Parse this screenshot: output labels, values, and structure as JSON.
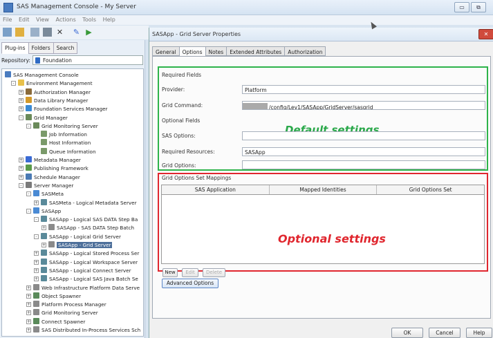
{
  "window": {
    "title": "SAS Management Console - My Server",
    "min_label": "▭",
    "max_label": "⧉"
  },
  "menu": [
    "File",
    "Edit",
    "View",
    "Actions",
    "Tools",
    "Help"
  ],
  "left": {
    "tabs": [
      "Plug-ins",
      "Folders",
      "Search"
    ],
    "repository_label": "Repository:",
    "repository_value": "Foundation",
    "tree": [
      {
        "label": "SAS Management Console",
        "level": 0,
        "exp": "",
        "color": "#4a7cc0"
      },
      {
        "label": "Environment Management",
        "level": 1,
        "exp": "-",
        "color": "#e8c04a"
      },
      {
        "label": "Authorization Manager",
        "level": 2,
        "exp": "+",
        "color": "#8a6a3a"
      },
      {
        "label": "Data Library Manager",
        "level": 2,
        "exp": "+",
        "color": "#d49a2a"
      },
      {
        "label": "Foundation Services Manager",
        "level": 2,
        "exp": "+",
        "color": "#3a8ad4"
      },
      {
        "label": "Grid Manager",
        "level": 2,
        "exp": "-",
        "color": "#6a8a5a"
      },
      {
        "label": "Grid Monitoring Server",
        "level": 3,
        "exp": "-",
        "color": "#6a8a5a"
      },
      {
        "label": "Job Information",
        "level": 4,
        "exp": "",
        "color": "#7a9a6a"
      },
      {
        "label": "Host Information",
        "level": 4,
        "exp": "",
        "color": "#7a9a6a"
      },
      {
        "label": "Queue Information",
        "level": 4,
        "exp": "",
        "color": "#7a9a6a"
      },
      {
        "label": "Metadata Manager",
        "level": 2,
        "exp": "+",
        "color": "#3a6ad4"
      },
      {
        "label": "Publishing Framework",
        "level": 2,
        "exp": "+",
        "color": "#5a9a4a"
      },
      {
        "label": "Schedule Manager",
        "level": 2,
        "exp": "+",
        "color": "#4a7ab4"
      },
      {
        "label": "Server Manager",
        "level": 2,
        "exp": "-",
        "color": "#7a7a7a"
      },
      {
        "label": "SASMeta",
        "level": 3,
        "exp": "-",
        "color": "#4a8ad4"
      },
      {
        "label": "SASMeta - Logical Metadata Server",
        "level": 4,
        "exp": "+",
        "color": "#5a8a9a"
      },
      {
        "label": "SASApp",
        "level": 3,
        "exp": "-",
        "color": "#4a8ad4"
      },
      {
        "label": "SASApp - Logical SAS DATA Step Ba",
        "level": 4,
        "exp": "-",
        "color": "#5a8a9a"
      },
      {
        "label": "SASApp - SAS DATA Step Batch",
        "level": 5,
        "exp": "+",
        "color": "#8a8a8a"
      },
      {
        "label": "SASApp - Logical Grid Server",
        "level": 4,
        "exp": "-",
        "color": "#5a8a9a"
      },
      {
        "label": "SASApp - Grid Server",
        "level": 5,
        "exp": "+",
        "color": "#8a8a8a",
        "selected": true
      },
      {
        "label": "SASApp - Logical Stored Process Ser",
        "level": 4,
        "exp": "+",
        "color": "#5a8a9a"
      },
      {
        "label": "SASApp - Logical Workspace Server",
        "level": 4,
        "exp": "+",
        "color": "#5a8a9a"
      },
      {
        "label": "SASApp - Logical Connect Server",
        "level": 4,
        "exp": "+",
        "color": "#5a8a9a"
      },
      {
        "label": "SASApp - Logical SAS Java Batch Se",
        "level": 4,
        "exp": "+",
        "color": "#5a8a9a"
      },
      {
        "label": "Web Infrastructure Platform Data Serve",
        "level": 3,
        "exp": "+",
        "color": "#8a8a8a"
      },
      {
        "label": "Object Spawner",
        "level": 3,
        "exp": "+",
        "color": "#5a8a5a"
      },
      {
        "label": "Platform Process Manager",
        "level": 3,
        "exp": "+",
        "color": "#8a8a8a"
      },
      {
        "label": "Grid Monitoring Server",
        "level": 3,
        "exp": "+",
        "color": "#8a8a8a"
      },
      {
        "label": "Connect Spawner",
        "level": 3,
        "exp": "+",
        "color": "#5a8a5a"
      },
      {
        "label": "SAS Distributed In-Process Services Sch",
        "level": 3,
        "exp": "+",
        "color": "#8a8a8a"
      }
    ]
  },
  "dialog": {
    "title": "SASApp - Grid Server Properties",
    "close_label": "✕",
    "tabs": [
      "General",
      "Options",
      "Notes",
      "Extended Attributes",
      "Authorization"
    ],
    "required_fields_label": "Required Fields",
    "provider_label": "Provider:",
    "provider_value": "Platform",
    "grid_command_label": "Grid Command:",
    "grid_command_value": "/config/Lev1/SASApp/GridServer/sasgrid",
    "optional_fields_label": "Optional Fields",
    "sas_options_label": "SAS Options:",
    "sas_options_value": "",
    "required_resources_label": "Required Resources:",
    "required_resources_value": "SASApp",
    "grid_options_label": "Grid Options:",
    "grid_options_value": "",
    "default_annotation": "Default settings",
    "mappings_label": "Grid Options Set Mappings",
    "mappings_columns": [
      "SAS Application",
      "Mapped Identities",
      "Grid Options Set"
    ],
    "optional_annotation": "Optional settings",
    "new_label": "New",
    "edit_label": "Edit",
    "delete_label": "Delete",
    "advanced_label": "Advanced Options",
    "ok_label": "OK",
    "cancel_label": "Cancel",
    "help_label": "Help"
  },
  "colors": {
    "default_box": "#2db34a",
    "optional_box": "#e0262e",
    "selection": "#4d6f9a"
  }
}
